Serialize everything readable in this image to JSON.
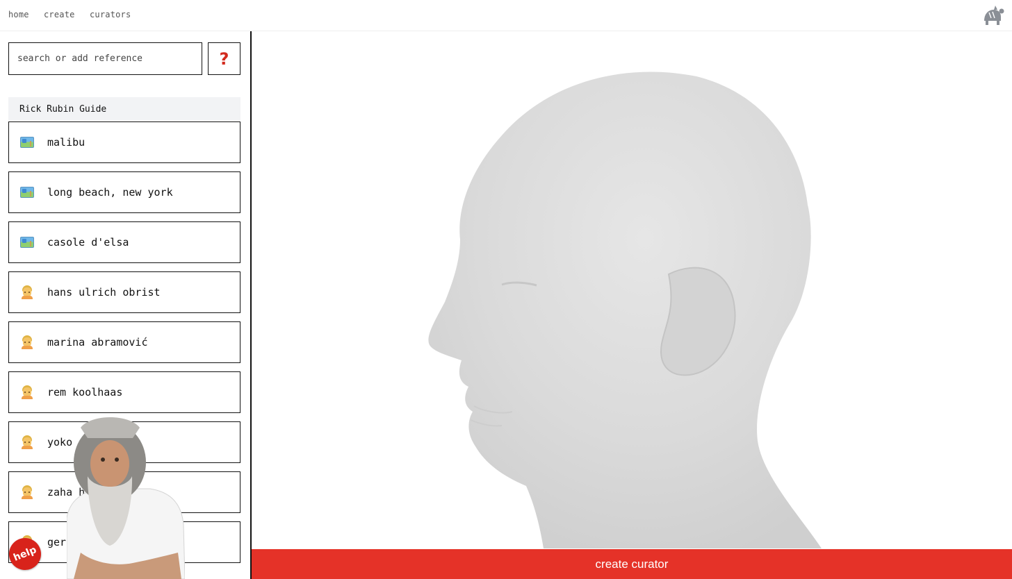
{
  "nav": {
    "links": [
      "home",
      "create",
      "curators"
    ]
  },
  "search": {
    "placeholder": "search or add reference",
    "help_label": "?"
  },
  "section": {
    "title": "Rick Rubin Guide"
  },
  "references": [
    {
      "icon": "map-icon",
      "label": "malibu"
    },
    {
      "icon": "map-icon",
      "label": "long beach, new york"
    },
    {
      "icon": "map-icon",
      "label": "casole d'elsa"
    },
    {
      "icon": "person-icon",
      "label": "hans ulrich obrist"
    },
    {
      "icon": "person-icon",
      "label": "marina abramović"
    },
    {
      "icon": "person-icon",
      "label": "rem koolhaas"
    },
    {
      "icon": "person-icon",
      "label": "yoko"
    },
    {
      "icon": "person-icon",
      "label": "zaha h"
    },
    {
      "icon": "person-icon",
      "label": "gerh"
    }
  ],
  "help_badge": {
    "label": "help"
  },
  "main": {
    "create_label": "create curator"
  },
  "colors": {
    "accent": "#e53228",
    "help_red": "#d22a1e",
    "section_bg": "#f2f3f5",
    "head_gray": "#dcdcdc"
  }
}
